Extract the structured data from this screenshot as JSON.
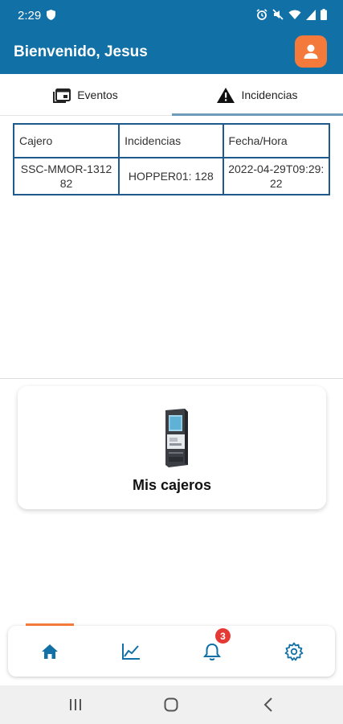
{
  "status_bar": {
    "time": "2:29",
    "icons": [
      "shield-icon",
      "alarm-icon",
      "mute-icon",
      "wifi-icon",
      "signal-icon",
      "battery-icon"
    ]
  },
  "header": {
    "title": "Bienvenido, Jesus",
    "profile_icon": "person-icon",
    "color_primary": "#1170a6",
    "color_accent": "#f47a3b"
  },
  "tabs": [
    {
      "label": "Eventos",
      "icon": "calendar-icon",
      "active": false
    },
    {
      "label": "Incidencias",
      "icon": "warning-icon",
      "active": true
    }
  ],
  "table": {
    "headers": [
      "Cajero",
      "Incidencias",
      "Fecha/Hora"
    ],
    "rows": [
      [
        "SSC-MMOR-131282",
        "HOPPER01: 128",
        "2022-04-29T09:29:22"
      ]
    ]
  },
  "card": {
    "label": "Mis cajeros",
    "icon": "kiosk-icon"
  },
  "bottom_nav": {
    "items": [
      "home-icon",
      "chart-icon",
      "bell-icon",
      "settings-icon"
    ],
    "active_index": 0,
    "notification_count": "3"
  },
  "system_nav": [
    "recents-icon",
    "home-circle-icon",
    "back-icon"
  ]
}
